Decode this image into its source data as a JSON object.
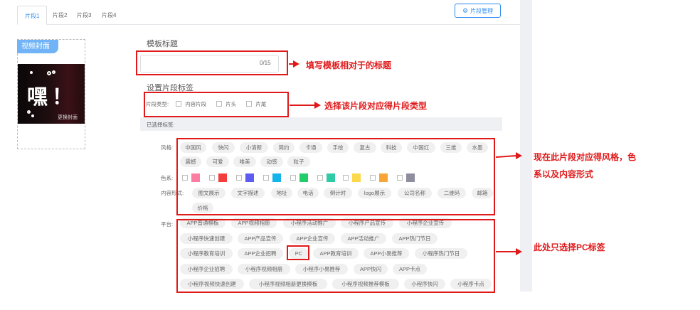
{
  "tabs": [
    "片段1",
    "片段2",
    "片段3",
    "片段4"
  ],
  "manage_button": "片段管理",
  "cover": {
    "badge": "视频封面",
    "big_text": "嘿！",
    "change_label": "更换封面"
  },
  "template_title": {
    "label": "模板标题",
    "counter": "0/15"
  },
  "segment_tags": {
    "label": "设置片段标签",
    "type_label": "片段类型:",
    "options": [
      "内容片段",
      "片头",
      "片尾"
    ]
  },
  "selected_label": "已选择标签:",
  "style": {
    "label": "风格:",
    "tags": [
      "中国风",
      "快闪",
      "小清新",
      "简约",
      "卡通",
      "手绘",
      "复古",
      "科技",
      "中国红",
      "三维",
      "水墨",
      "震撼",
      "可爱",
      "唯美",
      "动感",
      "粒子"
    ]
  },
  "color": {
    "label": "色系:",
    "swatches": [
      "#fb7da2",
      "#f43d3d",
      "#5c5cf0",
      "#14b4ea",
      "#22cc66",
      "#2fcaa6",
      "#fbd94a",
      "#f9a535",
      "#8e8e9e"
    ]
  },
  "content_form": {
    "label": "内容形式:",
    "tags": [
      "图文展示",
      "文字描述",
      "地址",
      "电话",
      "倒计时",
      "logo展示",
      "公司名称",
      "二维码",
      "邮箱",
      "价格"
    ]
  },
  "platform": {
    "label": "平台:",
    "tags": [
      "APP普通模板",
      "APP视频相册",
      "小程序活动推广",
      "小程序产品宣传",
      "小程序企业宣传",
      "小程序快速创建",
      "APP产品宣传",
      "APP企业宣传",
      "APP活动推广",
      "APP热门节日",
      "小程序教育培训",
      "APP企业招聘",
      "PC",
      "APP教育培训",
      "APP小易推荐",
      "小程序热门节日",
      "小程序企业招聘",
      "小程序视频相册",
      "小程序小易推荐",
      "APP快闪",
      "APP卡点",
      "小程序视频快速创建",
      "小程序视频相册更换模板",
      "小程序视频推荐模板",
      "小程序快闪",
      "小程序卡点"
    ]
  },
  "annotations": [
    "填写模板相对于的标题",
    "选择该片段对应得片段类型",
    "现在此片段对应得风格，色",
    "系以及内容形式",
    "此处只选择PC标签"
  ],
  "colors": {
    "accent": "#2d8cf0",
    "annotation_red": "#e0191a",
    "cover_badge": "#70b3f6"
  }
}
